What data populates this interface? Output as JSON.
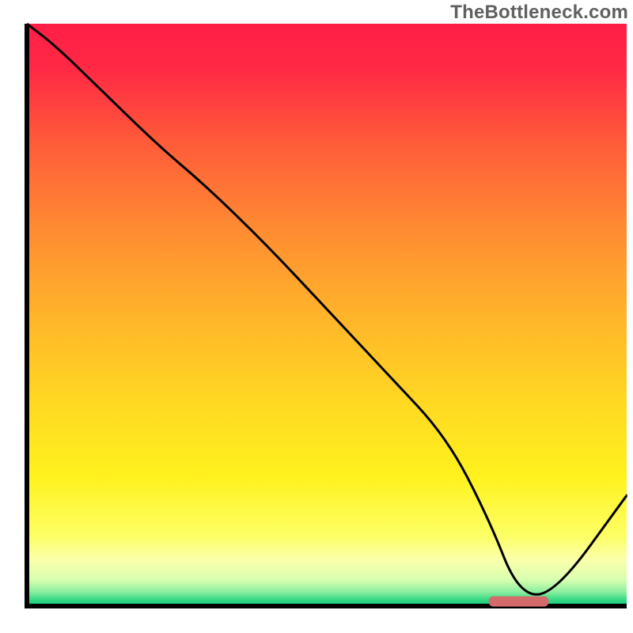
{
  "watermark": "TheBottleneck.com",
  "chart_data": {
    "type": "line",
    "title": "",
    "xlabel": "",
    "ylabel": "",
    "xlim": [
      0,
      100
    ],
    "ylim": [
      0,
      100
    ],
    "x": [
      0,
      5,
      12,
      22,
      30,
      40,
      50,
      60,
      70,
      77,
      82,
      88,
      100
    ],
    "values": [
      100,
      96,
      89,
      79,
      72,
      62,
      51,
      40,
      29,
      15,
      2,
      2,
      19
    ],
    "marker": {
      "present": true,
      "shape": "rounded-bar",
      "color": "#d46a6a",
      "x_range": [
        77,
        87
      ],
      "y": 0.8
    },
    "background_gradient": {
      "stops": [
        {
          "offset": 0.0,
          "color": "#ff1e46"
        },
        {
          "offset": 0.08,
          "color": "#ff2a44"
        },
        {
          "offset": 0.2,
          "color": "#ff5a3a"
        },
        {
          "offset": 0.35,
          "color": "#ff8a32"
        },
        {
          "offset": 0.5,
          "color": "#ffb42a"
        },
        {
          "offset": 0.65,
          "color": "#ffd822"
        },
        {
          "offset": 0.78,
          "color": "#fff21e"
        },
        {
          "offset": 0.88,
          "color": "#fdff66"
        },
        {
          "offset": 0.92,
          "color": "#fbffaa"
        },
        {
          "offset": 0.955,
          "color": "#d8ffb0"
        },
        {
          "offset": 0.975,
          "color": "#8fefa0"
        },
        {
          "offset": 0.99,
          "color": "#2fd884"
        },
        {
          "offset": 1.0,
          "color": "#18c878"
        }
      ]
    },
    "grid": false,
    "legend": null
  }
}
